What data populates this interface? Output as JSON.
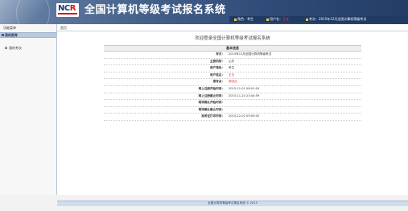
{
  "header": {
    "logo_main": "NC",
    "logo_accent": "R",
    "title": "全国计算机等级考试报名系统",
    "info": [
      {
        "label": "角色：",
        "value": "考生",
        "red": false
      },
      {
        "label": "用户名：",
        "value": "王五",
        "red": true
      },
      {
        "label": "考次：",
        "value": "2015年12月全国计算机等级考试",
        "red": false
      }
    ]
  },
  "sidebar": {
    "title": "功能菜单",
    "section": "我的报考",
    "items": [
      {
        "label": "我的考次"
      }
    ]
  },
  "main": {
    "breadcrumb": "首页",
    "welcome": "欢迎登录全国计算机等级考试报名系统",
    "section_title": "基本信息",
    "rows": [
      {
        "label": "考次：",
        "value": "2015年12月全国计算机等级考试",
        "red": false
      },
      {
        "label": "主管机构：",
        "value": "山东",
        "red": false
      },
      {
        "label": "用户角色：",
        "value": "考生",
        "red": false
      },
      {
        "label": "用户姓名：",
        "value": "王五",
        "red": true
      },
      {
        "label": "报考点：",
        "value": "测试点",
        "red": true
      },
      {
        "label": "网上注册开始时间：",
        "value": "2015-11-01 08:01:00",
        "red": false
      },
      {
        "label": "网上注册截止时间：",
        "value": "2015-11-24 23:44:59",
        "red": false
      },
      {
        "label": "现场确认开始时间：",
        "value": "",
        "red": false
      },
      {
        "label": "现场确认截止时间：",
        "value": "",
        "red": false
      },
      {
        "label": "准考证打印时间：",
        "value": "2015-12-02 09:00:00",
        "red": false
      }
    ]
  },
  "footer": {
    "text": "全国计算机等级考试报名系统 © 2015"
  },
  "colors": {
    "header_dark": "#233d66",
    "accent_red": "#d92020",
    "sidebar_bar": "#b8c8de"
  }
}
